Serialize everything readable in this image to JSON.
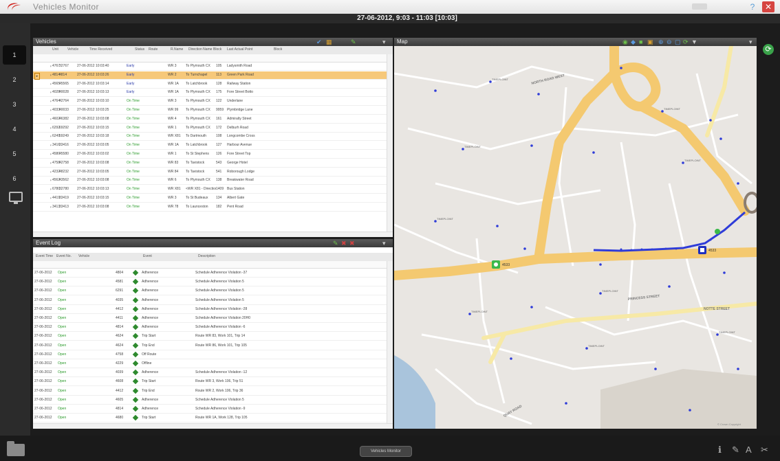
{
  "window": {
    "title": "Vehicles Monitor",
    "close_icon": "✕",
    "help_icon": "?"
  },
  "timebar": {
    "text": "27-06-2012, 9:03 - 11:03 [10:03]"
  },
  "leftnav": {
    "items": [
      "1",
      "2",
      "3",
      "4",
      "5",
      "6"
    ]
  },
  "vehicles": {
    "title": "Vehicles",
    "columns": [
      "Unit",
      "Vehicle",
      "Time Received",
      "Status",
      "Route",
      "R.Name",
      "Direction Name",
      "Block",
      "Last Actual Point",
      "Block"
    ],
    "rows": [
      {
        "unit": "4767",
        "vehicle": "32767",
        "time": "27-06-2012 10:03:40",
        "status": "Early",
        "route": "",
        "rname": "WR 3",
        "dir": "To Plymouth CX",
        "block": "105",
        "point": "Ladysmith Road",
        "selected": false
      },
      {
        "unit": "4814",
        "vehicle": "4814",
        "time": "27-06-2012 10:03:26",
        "status": "Early",
        "route": "",
        "rname": "WR 2",
        "dir": "To Turnchapel",
        "block": "113",
        "point": "Green Park Road",
        "selected": true
      },
      {
        "unit": "4565",
        "vehicle": "45565",
        "time": "27-06-2012 10:03:14",
        "status": "Early",
        "route": "",
        "rname": "WR 1A",
        "dir": "To Latchbrook",
        "block": "128",
        "point": "Railway Station",
        "selected": false
      },
      {
        "unit": "4028",
        "vehicle": "40028",
        "time": "27-06-2012 10:03:13",
        "status": "Early",
        "route": "",
        "rname": "WR 1A",
        "dir": "To Plymouth CX",
        "block": "175",
        "point": "Fore Street Botto",
        "selected": false
      },
      {
        "unit": "4764",
        "vehicle": "42764",
        "time": "27-06-2012 10:03:10",
        "status": "On Time",
        "route": "",
        "rname": "WR 3",
        "dir": "To Plymouth CX",
        "block": "122",
        "point": "Underlane",
        "selected": false
      },
      {
        "unit": "4033",
        "vehicle": "40033",
        "time": "27-06-2012 10:03:25",
        "status": "On Time",
        "route": "",
        "rname": "WR 99",
        "dir": "To Plymouth CX",
        "block": "9959",
        "point": "Plymbridge Lane",
        "selected": false
      },
      {
        "unit": "4602",
        "vehicle": "46382",
        "time": "27-06-2012 10:03:08",
        "status": "On Time",
        "route": "",
        "rname": "WR 4",
        "dir": "To Plymouth CX",
        "block": "161",
        "point": "Admiralty Street",
        "selected": false
      },
      {
        "unit": "6292",
        "vehicle": "69292",
        "time": "27-06-2012 10:03:15",
        "status": "On Time",
        "route": "",
        "rname": "WR 1",
        "dir": "To Plymouth CX",
        "block": "172",
        "point": "Delburh Road",
        "selected": false
      },
      {
        "unit": "6249",
        "vehicle": "59249",
        "time": "27-06-2012 10:03:18",
        "status": "On Time",
        "route": "",
        "rname": "WR X81",
        "dir": "To Dartmouth",
        "block": "108",
        "point": "Longcombe Cross",
        "selected": false
      },
      {
        "unit": "3416",
        "vehicle": "33416",
        "time": "27-06-2012 10:03:05",
        "status": "On Time",
        "route": "",
        "rname": "WR 1A",
        "dir": "To Latchbrook",
        "block": "127",
        "point": "Harbour Avenue",
        "selected": false
      },
      {
        "unit": "4580",
        "vehicle": "45580",
        "time": "27-06-2012 10:03:02",
        "status": "On Time",
        "route": "",
        "rname": "WR 1",
        "dir": "To St Stephens",
        "block": "126",
        "point": "Fore Street Top",
        "selected": false
      },
      {
        "unit": "4758",
        "vehicle": "42758",
        "time": "27-06-2012 10:03:08",
        "status": "On Time",
        "route": "",
        "rname": "WR 83",
        "dir": "To Tavistock",
        "block": "543",
        "point": "George Hotel",
        "selected": false
      },
      {
        "unit": "4232",
        "vehicle": "48232",
        "time": "27-06-2012 10:03:05",
        "status": "On Time",
        "route": "",
        "rname": "WR 84",
        "dir": "To Tavistock",
        "block": "541",
        "point": "Roborough Lodge",
        "selected": false
      },
      {
        "unit": "4562",
        "vehicle": "43562",
        "time": "27-06-2012 10:03:08",
        "status": "On Time",
        "route": "",
        "rname": "WR 6",
        "dir": "To Plymouth CX",
        "block": "138",
        "point": "Breakwater Road",
        "selected": false
      },
      {
        "unit": "6780",
        "vehicle": "32780",
        "time": "27-06-2012 10:03:13",
        "status": "On Time",
        "route": "",
        "rname": "WR X81",
        "dir": "<WR X81 - Direction",
        "block": "1409",
        "point": "Bus Station",
        "selected": false
      },
      {
        "unit": "4419",
        "vehicle": "33419",
        "time": "27-06-2012 10:03:15",
        "status": "On Time",
        "route": "",
        "rname": "WR 3",
        "dir": "To St Budeaux",
        "block": "134",
        "point": "Albert Gate",
        "selected": false
      },
      {
        "unit": "3413",
        "vehicle": "33413",
        "time": "27-06-2012 10:03:08",
        "status": "On Time",
        "route": "",
        "rname": "WR 78",
        "dir": "To Launceston",
        "block": "182",
        "point": "Pent Road",
        "selected": false
      }
    ]
  },
  "eventlog": {
    "title": "Event Log",
    "columns": [
      "Event Time",
      "Event No.",
      "Vehicle",
      "Event",
      "Description"
    ],
    "rows": [
      {
        "date": "27-06-2012",
        "time": "Open",
        "vehicle": "4804",
        "event": "Adherence",
        "desc": "Schedule Adherence Violation -37"
      },
      {
        "date": "27-06-2012",
        "time": "Open",
        "vehicle": "4581",
        "event": "Adherence",
        "desc": "Schedule Adherence Violation 5"
      },
      {
        "date": "27-06-2012",
        "time": "Open",
        "vehicle": "6291",
        "event": "Adherence",
        "desc": "Schedule Adherence Violation 5"
      },
      {
        "date": "27-06-2012",
        "time": "Open",
        "vehicle": "4035",
        "event": "Adherence",
        "desc": "Schedule Adherence Violation 5"
      },
      {
        "date": "27-06-2012",
        "time": "Open",
        "vehicle": "4412",
        "event": "Adherence",
        "desc": "Schedule Adherence Violation -28"
      },
      {
        "date": "27-06-2012",
        "time": "Open",
        "vehicle": "4411",
        "event": "Adherence",
        "desc": "Schedule Adherence Violation 20H0"
      },
      {
        "date": "27-06-2012",
        "time": "Open",
        "vehicle": "4814",
        "event": "Adherence",
        "desc": "Schedule Adherence Violation -6"
      },
      {
        "date": "27-06-2012",
        "time": "Open",
        "vehicle": "4624",
        "event": "Trip Start",
        "desc": "Route WR 83, Work 101, Trip 14"
      },
      {
        "date": "27-06-2012",
        "time": "Open",
        "vehicle": "4624",
        "event": "Trip End",
        "desc": "Route WR 86, Work 101, Trip 105"
      },
      {
        "date": "27-06-2012",
        "time": "Open",
        "vehicle": "4758",
        "event": "Off Route",
        "desc": ""
      },
      {
        "date": "27-06-2012",
        "time": "Open",
        "vehicle": "4229",
        "event": "Offline",
        "desc": ""
      },
      {
        "date": "27-06-2012",
        "time": "Open",
        "vehicle": "4039",
        "event": "Adherence",
        "desc": "Schedule Adherence Violation -12"
      },
      {
        "date": "27-06-2012",
        "time": "Open",
        "vehicle": "4608",
        "event": "Trip Start",
        "desc": "Route WR 3, Work 106, Trip 51"
      },
      {
        "date": "27-06-2012",
        "time": "Open",
        "vehicle": "4412",
        "event": "Trip End",
        "desc": "Route WR 2, Work 106, Trip 36"
      },
      {
        "date": "27-06-2012",
        "time": "Open",
        "vehicle": "4605",
        "event": "Adherence",
        "desc": "Schedule Adherence Violation 5"
      },
      {
        "date": "27-06-2012",
        "time": "Open",
        "vehicle": "4814",
        "event": "Adherence",
        "desc": "Schedule Adherence Violation -9"
      },
      {
        "date": "27-06-2012",
        "time": "Open",
        "vehicle": "4680",
        "event": "Trip Start",
        "desc": "Route WR 1A, Work 128, Trip 105"
      }
    ]
  },
  "map": {
    "title": "Map",
    "streets": [
      "NORTH ROAD WEST",
      "PRINCESS STREET",
      "NOTTE STREET",
      "QUAY ROAD"
    ],
    "stop_label": "TIMEPLOINT",
    "marker_labels": [
      "4533",
      "4533"
    ],
    "copyright": "© Crown Copyright"
  },
  "bottombar": {
    "center_label": "Vehicles Monitor"
  },
  "colors": {
    "accent_orange": "#f6c87a",
    "route_blue": "#2f3cd8",
    "road_yellow": "#f4c970",
    "early": "#2a3aa8",
    "on_time": "#2a9a2a"
  }
}
